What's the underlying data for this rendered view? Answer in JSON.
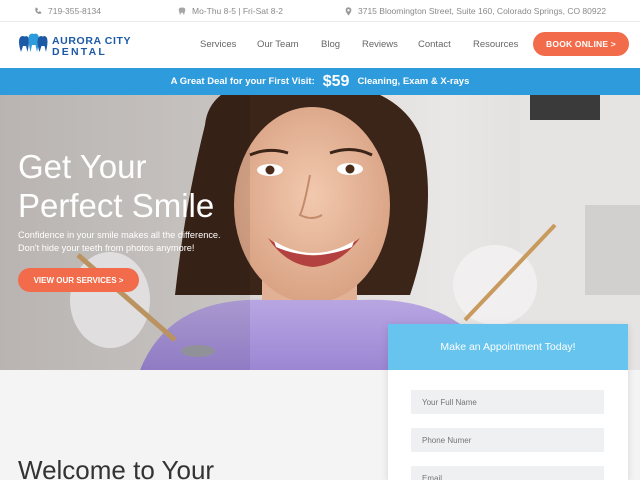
{
  "topbar": {
    "phone": "719-355-8134",
    "hours": "Mo-Thu 8-5 | Fri-Sat 8-2",
    "address": "3715 Bloomington Street, Suite 160, Colorado Springs, CO 80922"
  },
  "brand": {
    "line1": "AURORA CITY",
    "line2": "DENTAL"
  },
  "nav": {
    "items": [
      "Services",
      "Our Team",
      "Blog",
      "Reviews",
      "Contact",
      "Resources"
    ],
    "book_label": "BOOK ONLINE >"
  },
  "promo": {
    "lead": "A Great Deal for your First Visit:",
    "price": "$59",
    "tail": "Cleaning, Exam & X-rays"
  },
  "hero": {
    "title_line1": "Get Your",
    "title_line2": "Perfect Smile",
    "sub_line1": "Confidence in your smile makes all the difference.",
    "sub_line2": "Don't hide your teeth from photos anymore!",
    "cta_label": "VIEW OUR SERVICES >"
  },
  "appointment": {
    "title": "Make an Appointment Today!",
    "name_placeholder": "Your Full Name",
    "phone_placeholder": "Phone Numer",
    "email_placeholder": "Email"
  },
  "welcome": {
    "heading": "Welcome to Your"
  },
  "colors": {
    "accent": "#f26b4a",
    "promo_band": "#2d9bdc",
    "form_header": "#66c4ee",
    "brand_blue": "#1c5aa6"
  },
  "icons": {
    "phone": "phone-icon",
    "hours": "tooth-icon",
    "address": "map-pin-icon"
  }
}
